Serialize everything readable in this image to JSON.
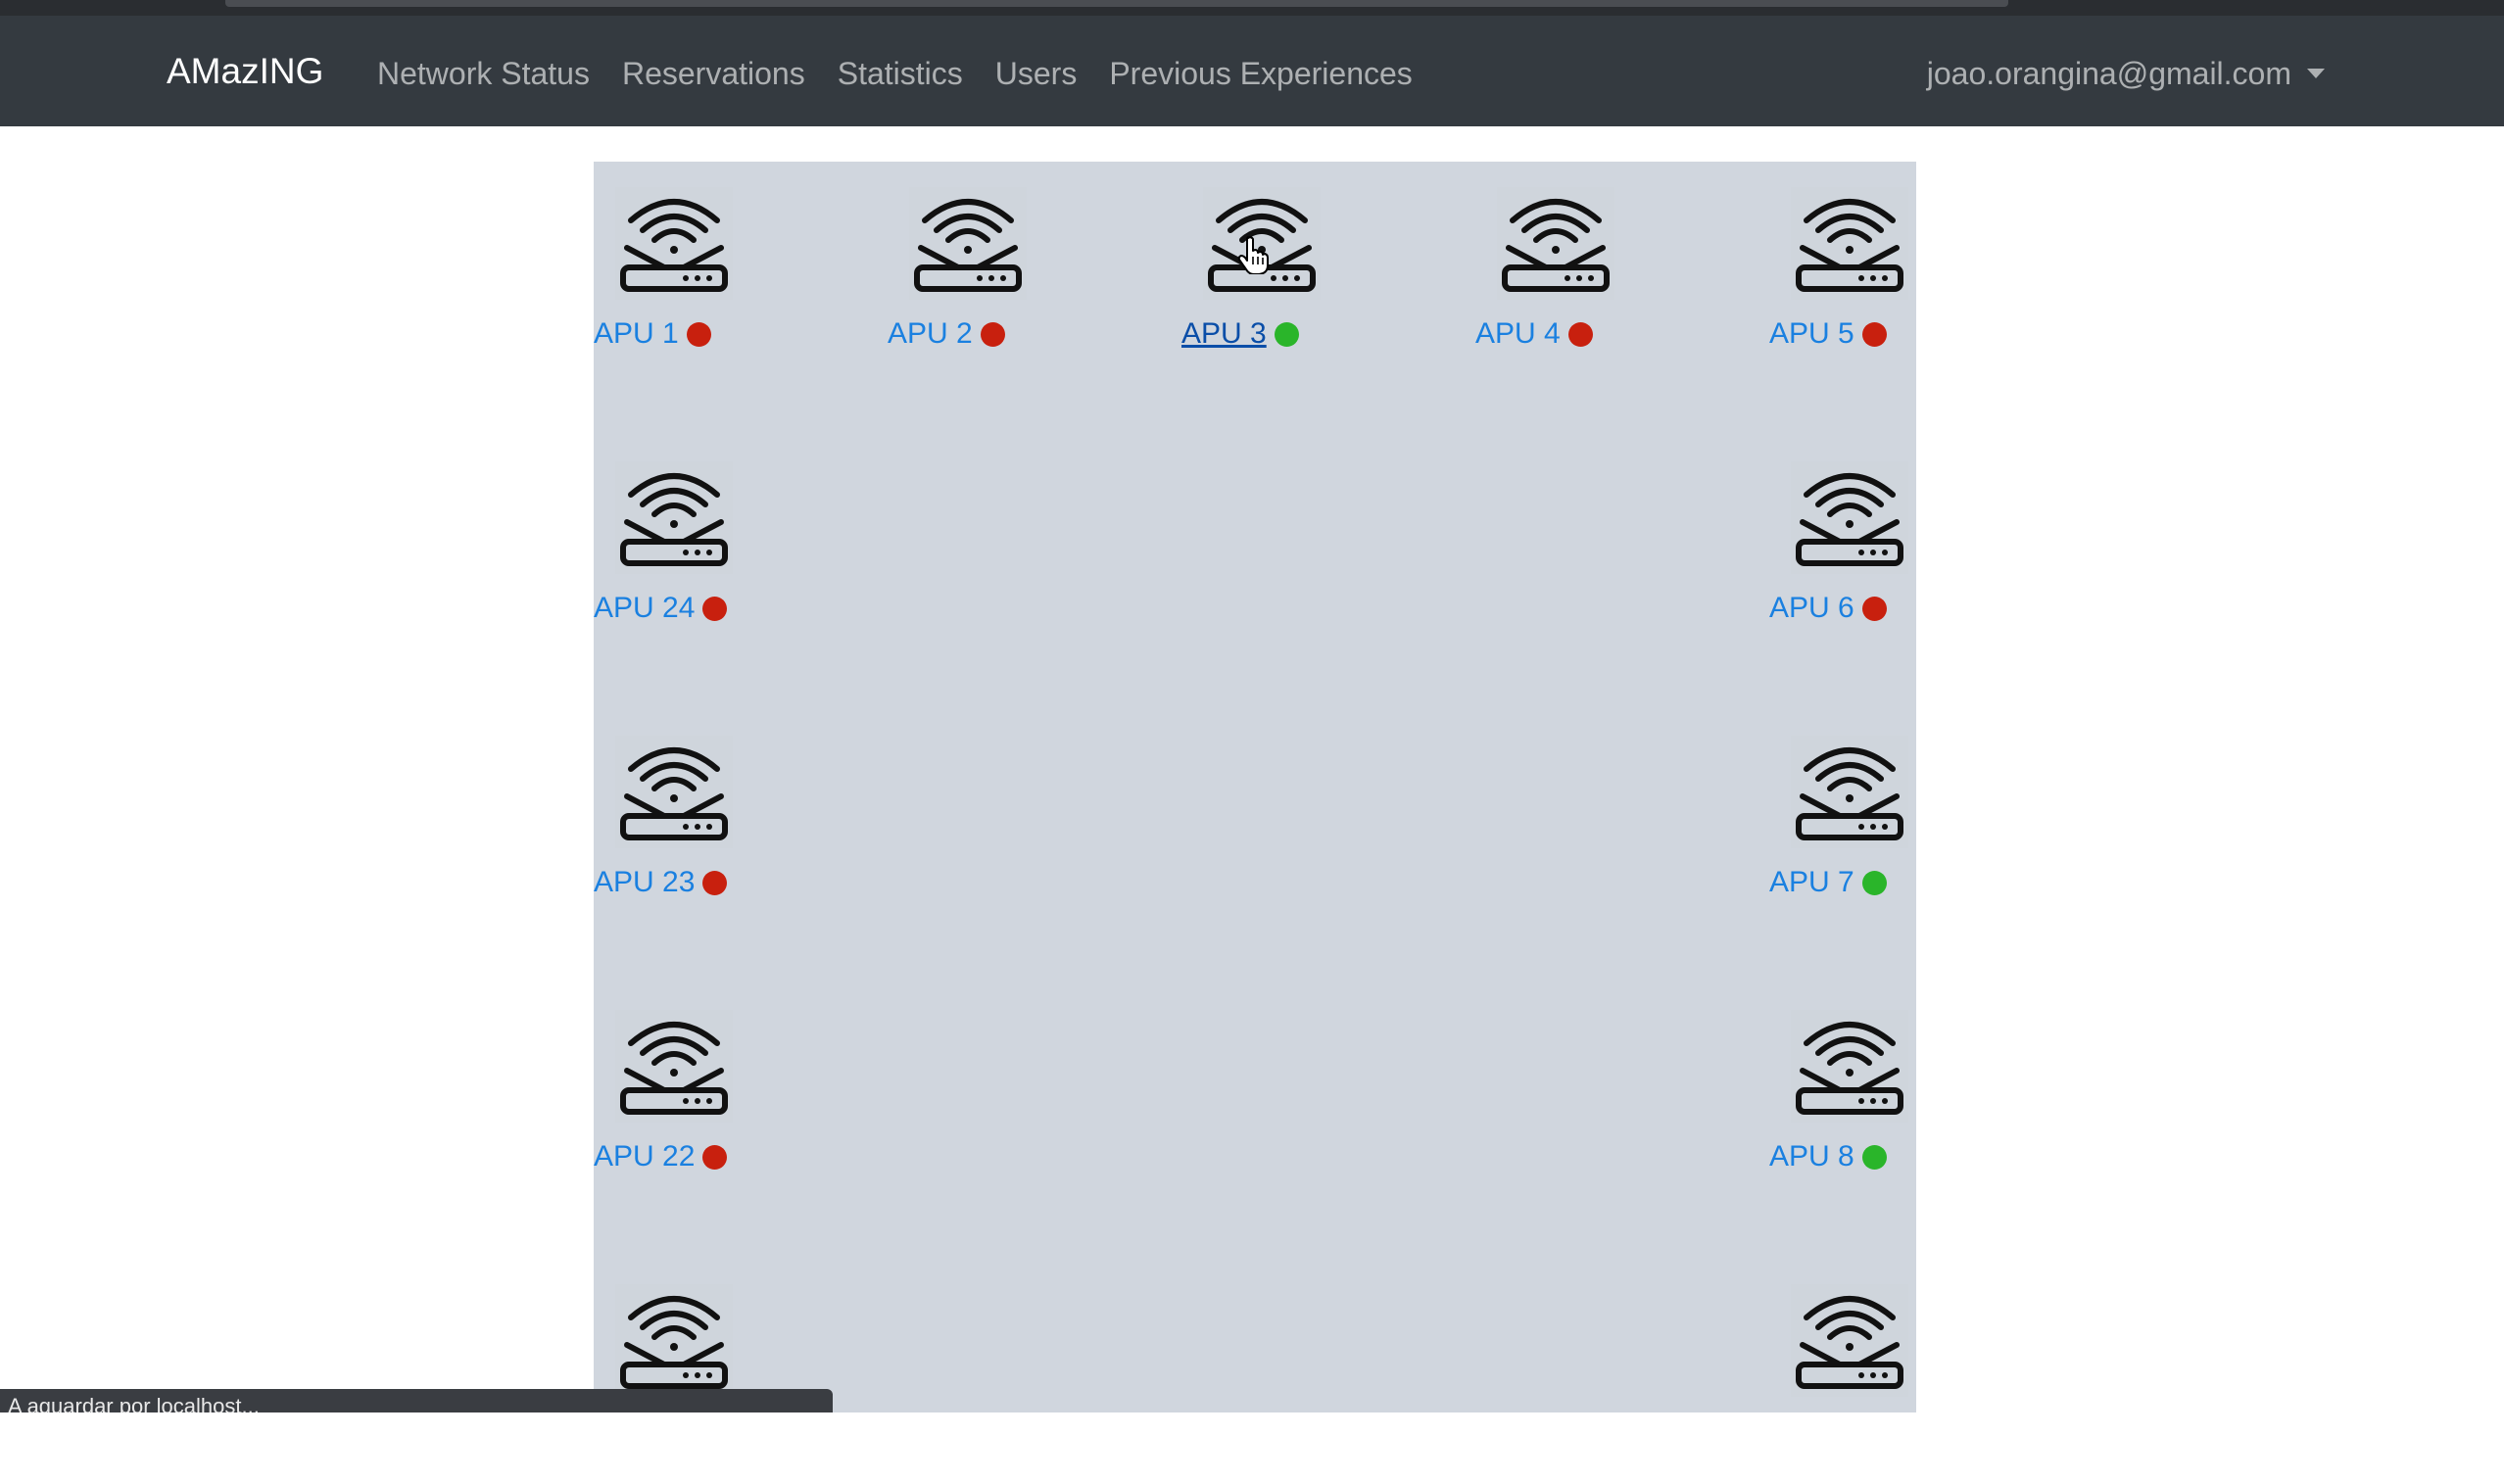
{
  "navbar": {
    "brand": "AMazING",
    "links": [
      {
        "label": "Network Status"
      },
      {
        "label": "Reservations"
      },
      {
        "label": "Statistics"
      },
      {
        "label": "Users"
      },
      {
        "label": "Previous Experiences"
      }
    ],
    "user_email": "joao.orangina@gmail.com"
  },
  "status_colors": {
    "online": "#2ab52a",
    "offline": "#c8200e"
  },
  "nodes": [
    {
      "label": "APU 1",
      "status": "offline"
    },
    {
      "label": "APU 2",
      "status": "offline"
    },
    {
      "label": "APU 3",
      "status": "online"
    },
    {
      "label": "APU 4",
      "status": "offline"
    },
    {
      "label": "APU 5",
      "status": "offline"
    },
    {
      "label": "APU 24",
      "status": "offline"
    },
    {
      "label": "APU 6",
      "status": "offline"
    },
    {
      "label": "APU 23",
      "status": "offline"
    },
    {
      "label": "APU 7",
      "status": "online"
    },
    {
      "label": "APU 22",
      "status": "offline"
    },
    {
      "label": "APU 8",
      "status": "online"
    },
    {
      "icon": "router-wifi-icon"
    },
    {
      "icon": "router-wifi-icon"
    }
  ],
  "browser_status": "A aguardar por localhost..."
}
